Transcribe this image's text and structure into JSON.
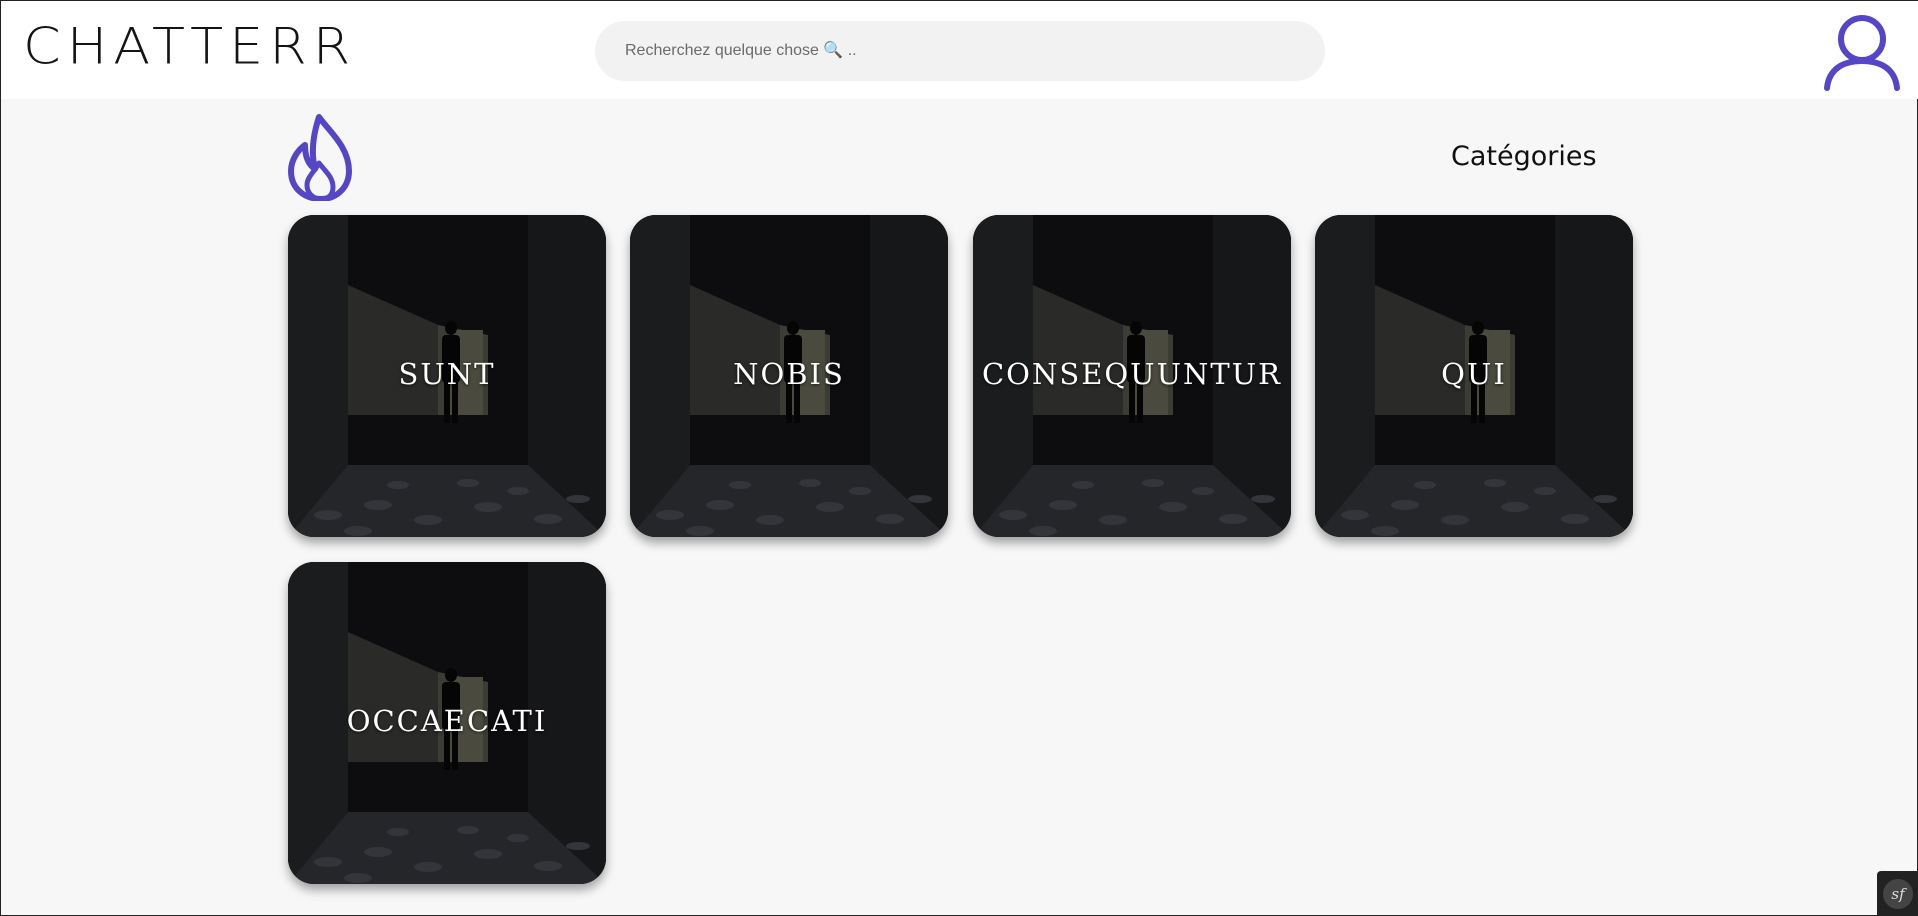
{
  "header": {
    "logo": "CHATTERR",
    "search_placeholder": "Recherchez quelque chose 🔍 ..",
    "avatar_icon": "user-icon"
  },
  "section": {
    "icon": "flame-icon",
    "title": "Catégories",
    "accent_color": "#5546c8"
  },
  "categories": [
    {
      "label": "SUNT"
    },
    {
      "label": "NOBIS"
    },
    {
      "label": "CONSEQUUNTUR"
    },
    {
      "label": "QUI"
    },
    {
      "label": "OCCAECATI"
    }
  ],
  "toolbar": {
    "badge": "sf"
  }
}
